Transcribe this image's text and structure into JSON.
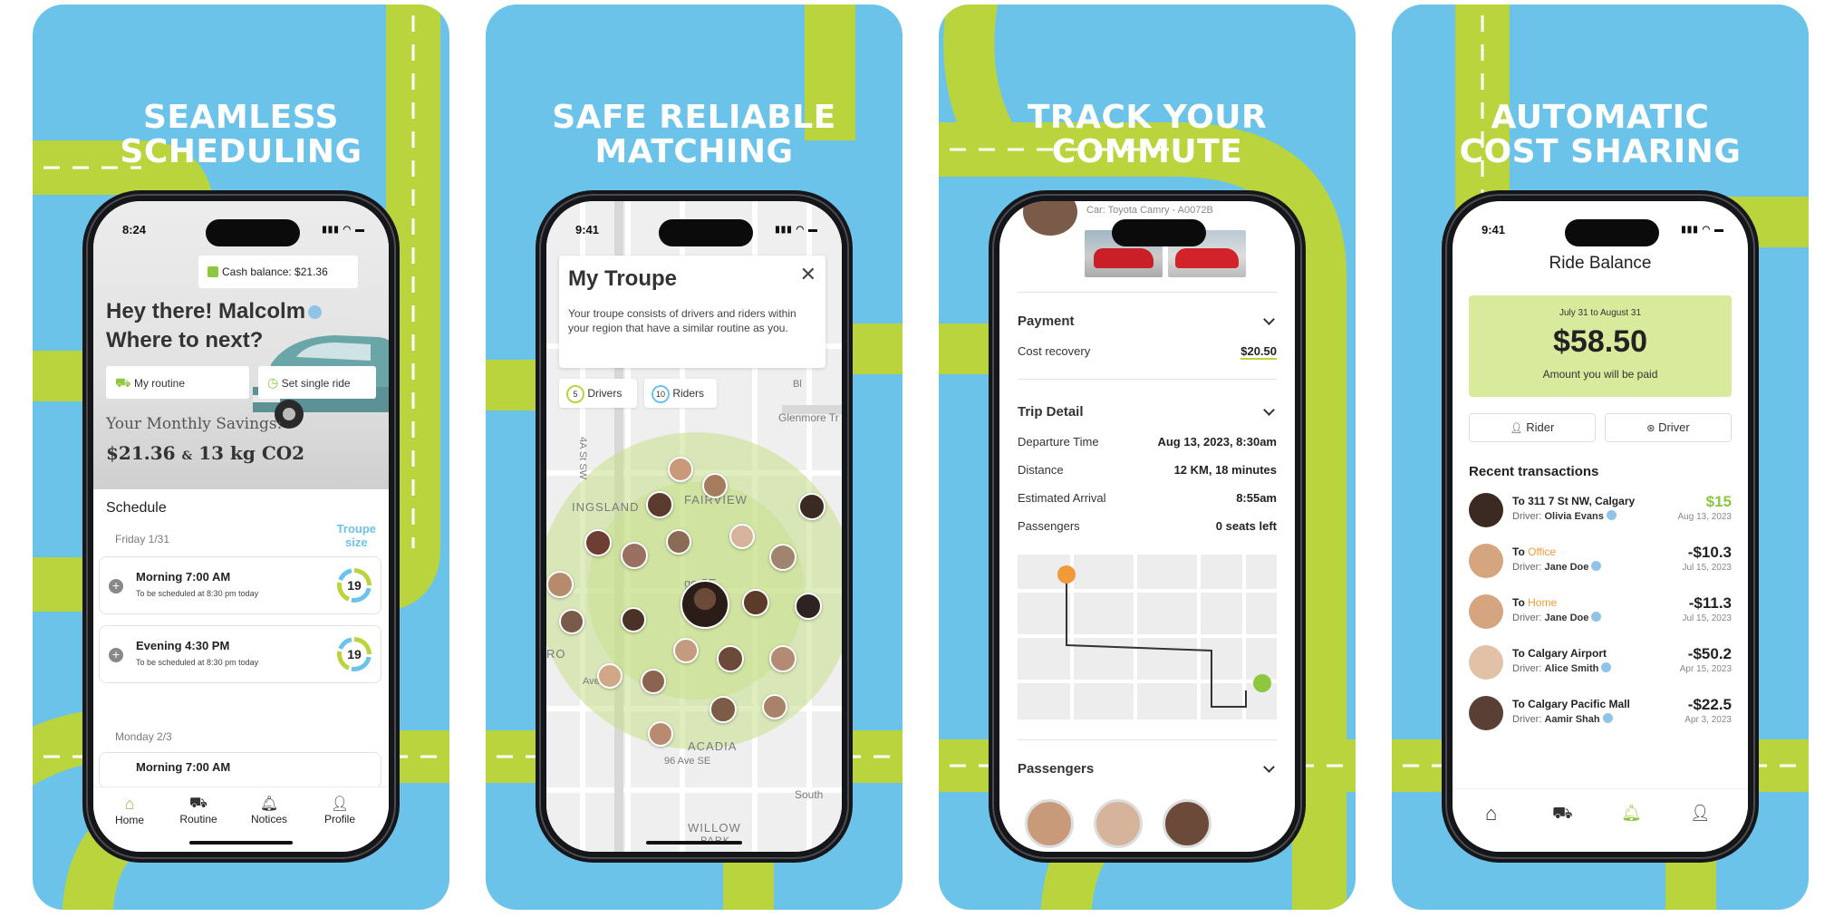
{
  "colors": {
    "sky": "#6cc3ea",
    "road": "#b9d43d",
    "accent_green": "#8dc63f",
    "orange": "#f29a3a"
  },
  "panels": [
    {
      "headline": [
        "SEAMLESS",
        "SCHEDULING"
      ],
      "status_time": "8:24",
      "cash_balance": "Cash balance: $21.36",
      "greeting_line1": "Hey there! Malcolm",
      "greeting_line2": "Where to next?",
      "my_routine": "My routine",
      "set_single_ride": "Set single ride",
      "savings_label": "Your Monthly Savings:",
      "savings_money": "$21.36",
      "savings_amp": "&",
      "savings_co2": "13 kg CO2",
      "schedule_title": "Schedule",
      "troupe_size": [
        "Troupe",
        "size"
      ],
      "day1": "Friday 1/31",
      "rides": [
        {
          "title": "Morning 7:00 AM",
          "sub": "To be scheduled at 8:30 pm today",
          "count": "19"
        },
        {
          "title": "Evening 4:30 PM",
          "sub": "To be scheduled at 8:30 pm today",
          "count": "19"
        }
      ],
      "day2": "Monday 2/3",
      "partial_ride": "Morning 7:00 AM",
      "nav": [
        "Home",
        "Routine",
        "Notices",
        "Profile"
      ]
    },
    {
      "headline": [
        "SAFE RELIABLE",
        "MATCHING"
      ],
      "status_time": "9:41",
      "troupe_title": "My Troupe",
      "troupe_desc": "Your troupe consists of drivers and riders within your region that have a similar routine as you.",
      "drivers_count": "5",
      "drivers_label": "Drivers",
      "riders_count": "10",
      "riders_label": "Riders",
      "map_labels": [
        "Glenmore Tr",
        "4A St SW",
        "INGSLAND",
        "FAIRVIEW",
        "RO",
        "ge SE",
        "ACADIA",
        "96 Ave SE",
        "South",
        "WILLOW",
        "PARK",
        "Bl",
        "Ave SE"
      ]
    },
    {
      "headline": [
        "TRACK YOUR",
        "COMMUTE"
      ],
      "car_text": "Car: Toyota Camry - A0072B",
      "payment_title": "Payment",
      "cost_recovery_label": "Cost recovery",
      "cost_recovery_value": "$20.50",
      "trip_title": "Trip Detail",
      "trip_rows": [
        {
          "label": "Departure Time",
          "value": "Aug 13, 2023, 8:30am"
        },
        {
          "label": "Distance",
          "value": "12 KM, 18 minutes"
        },
        {
          "label": "Estimated Arrival",
          "value": "8:55am"
        },
        {
          "label": "Passengers",
          "value": "0 seats left"
        }
      ],
      "passengers_title": "Passengers"
    },
    {
      "headline": [
        "AUTOMATIC",
        "COST SHARING"
      ],
      "status_time": "9:41",
      "title": "Ride Balance",
      "period": "July 31 to August 31",
      "amount": "$58.50",
      "amount_caption": "Amount you will be paid",
      "rider_button": "Rider",
      "driver_button": "Driver",
      "recent_title": "Recent transactions",
      "transactions": [
        {
          "to_prefix": "To 311 7 St NW, Calgary",
          "to_place": "",
          "driver_label": "Driver:",
          "driver": "Olivia Evans",
          "amount": "$15",
          "date": "Aug 13, 2023",
          "positive": true
        },
        {
          "to_prefix": "To ",
          "to_place": "Office",
          "driver_label": "Driver:",
          "driver": "Jane Doe",
          "amount": "-$10.3",
          "date": "Jul 15, 2023",
          "positive": false
        },
        {
          "to_prefix": "To ",
          "to_place": "Home",
          "driver_label": "Driver:",
          "driver": "Jane Doe",
          "amount": "-$11.3",
          "date": "Jul 15, 2023",
          "positive": false
        },
        {
          "to_prefix": "To Calgary Airport",
          "to_place": "",
          "driver_label": "Driver:",
          "driver": "Alice Smith",
          "amount": "-$50.2",
          "date": "Apr 15, 2023",
          "positive": false
        },
        {
          "to_prefix": "To Calgary Pacific Mall",
          "to_place": "",
          "driver_label": "Driver:",
          "driver": "Aamir Shah",
          "amount": "-$22.5",
          "date": "Apr 3, 2023",
          "positive": false
        }
      ]
    }
  ]
}
